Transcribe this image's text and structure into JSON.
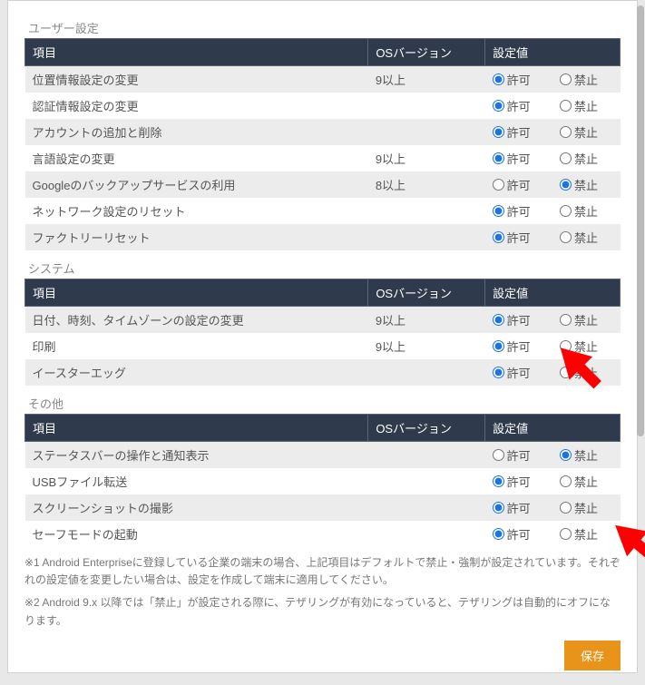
{
  "headers": {
    "item": "項目",
    "os": "OSバージョン",
    "value": "設定値"
  },
  "radio": {
    "allow": "許可",
    "deny": "禁止"
  },
  "sections": [
    {
      "title": "ユーザー設定",
      "rows": [
        {
          "item": "位置情報設定の変更",
          "os": "9以上",
          "sel": "allow"
        },
        {
          "item": "認証情報設定の変更",
          "os": "",
          "sel": "allow"
        },
        {
          "item": "アカウントの追加と削除",
          "os": "",
          "sel": "allow"
        },
        {
          "item": "言語設定の変更",
          "os": "9以上",
          "sel": "allow"
        },
        {
          "item": "Googleのバックアップサービスの利用",
          "os": "8以上",
          "sel": "deny"
        },
        {
          "item": "ネットワーク設定のリセット",
          "os": "",
          "sel": "allow"
        },
        {
          "item": "ファクトリーリセット",
          "os": "",
          "sel": "allow"
        }
      ]
    },
    {
      "title": "システム",
      "rows": [
        {
          "item": "日付、時刻、タイムゾーンの設定の変更",
          "os": "9以上",
          "sel": "allow"
        },
        {
          "item": "印刷",
          "os": "9以上",
          "sel": "allow"
        },
        {
          "item": "イースターエッグ",
          "os": "",
          "sel": "allow"
        }
      ]
    },
    {
      "title": "その他",
      "rows": [
        {
          "item": "ステータスバーの操作と通知表示",
          "os": "",
          "sel": "deny"
        },
        {
          "item": "USBファイル転送",
          "os": "",
          "sel": "allow"
        },
        {
          "item": "スクリーンショットの撮影",
          "os": "",
          "sel": "allow"
        },
        {
          "item": "セーフモードの起動",
          "os": "",
          "sel": "allow"
        }
      ]
    }
  ],
  "note1": "※1 Android Enterpriseに登録している企業の端末の場合、上記項目はデフォルトで禁止・強制が設定されています。それぞれの設定値を変更したい場合は、設定を作成して端末に適用してください。",
  "note2": "※2 Android 9.x 以降では「禁止」が設定される際に、テザリングが有効になっていると、テザリングは自動的にオフになります。",
  "save": "保存"
}
